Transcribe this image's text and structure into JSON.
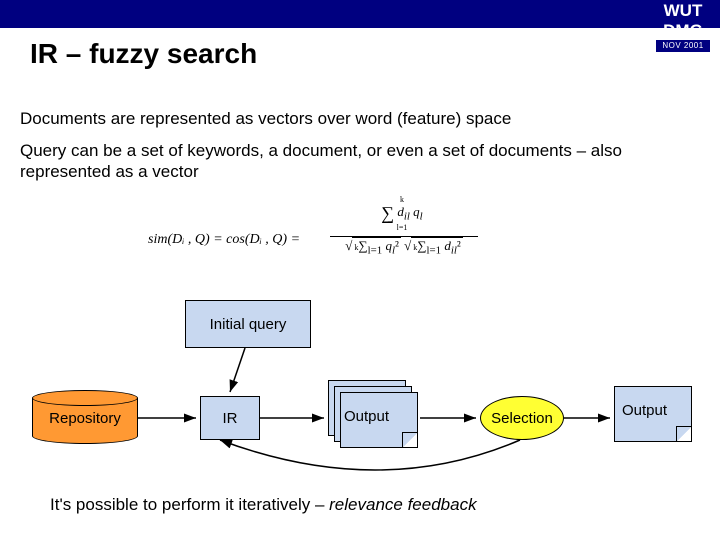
{
  "badge": {
    "line1": "WUT",
    "line2": "DMG",
    "sub": "NOV 2001"
  },
  "title": "IR – fuzzy search",
  "paragraphs": {
    "p1": "Documents are represented as vectors over word (feature) space",
    "p2": "Query can be a set of keywords, a document, or even a set of documents – also represented as a vector"
  },
  "formula": {
    "lhs": "sim(Dᵢ , Q) = cos(Dᵢ , Q) =",
    "num": "Σ dᵢₗ qₗ  (l=1..k)",
    "den": "√(Σ qₗ²) · √(Σ dᵢₗ²)  (l=1..k)"
  },
  "diagram": {
    "initial_query": "Initial query",
    "repository": "Repository",
    "ir": "IR",
    "output1": "Output",
    "selection": "Selection",
    "output2": "Output"
  },
  "caption_prefix": "It's possible to perform it iteratively – ",
  "caption_em": "relevance feedback"
}
